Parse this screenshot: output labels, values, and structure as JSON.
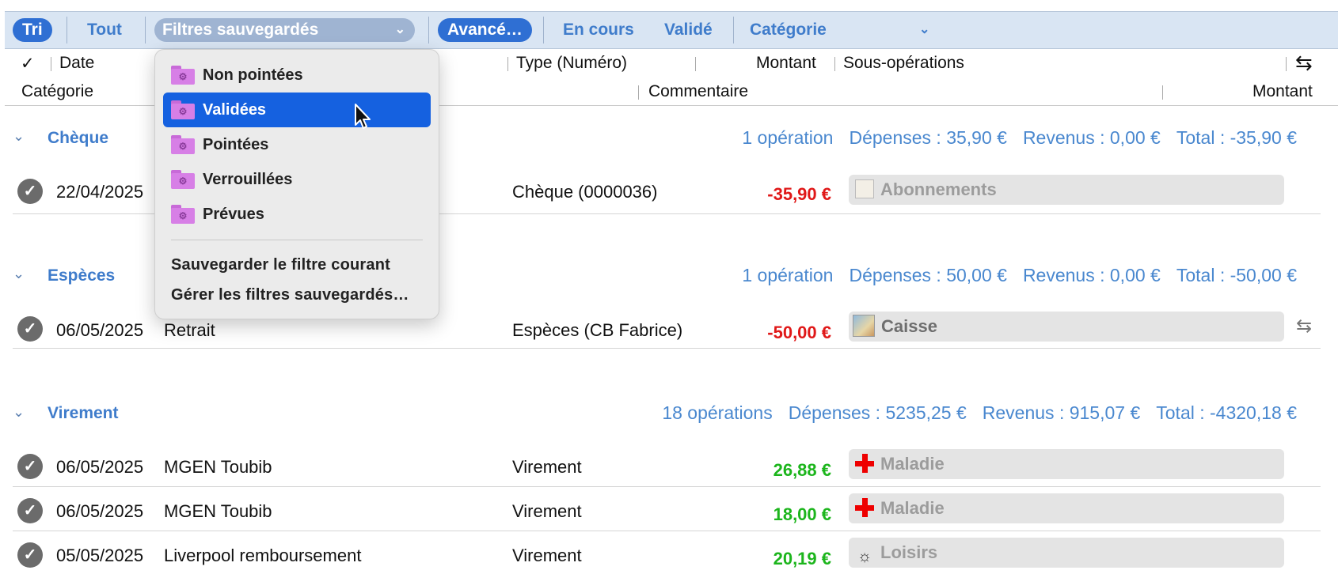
{
  "toolbar": {
    "sort": "Tri",
    "all": "Tout",
    "saved_filters": "Filtres sauvegardés",
    "advanced": "Avancé…",
    "in_progress": "En cours",
    "validated": "Validé",
    "category": "Catégorie"
  },
  "headers": {
    "check": "✓",
    "date": "Date",
    "type": "Type (Numéro)",
    "amount": "Montant",
    "sub_ops": "Sous-opérations",
    "category": "Catégorie",
    "comment": "Commentaire",
    "sub_amount": "Montant"
  },
  "menu": {
    "items": [
      "Non pointées",
      "Validées",
      "Pointées",
      "Verrouillées",
      "Prévues"
    ],
    "selected": "Validées",
    "save_current": "Sauvegarder le filtre courant",
    "manage": "Gérer les filtres sauvegardés…"
  },
  "groups": [
    {
      "title": "Chèque",
      "count": "1 opération",
      "expenses": "Dépenses : 35,90 €",
      "income": "Revenus : 0,00 €",
      "total": "Total : -35,90 €",
      "rows": [
        {
          "date": "22/04/2025",
          "label": "",
          "type": "Chèque (0000036)",
          "amount": "-35,90 €",
          "category": "Abonnements",
          "icon": "newspaper-icon"
        }
      ]
    },
    {
      "title": "Espèces",
      "count": "1 opération",
      "expenses": "Dépenses : 50,00 €",
      "income": "Revenus : 0,00 €",
      "total": "Total : -50,00 €",
      "rows": [
        {
          "date": "06/05/2025",
          "label": "Retrait",
          "type": "Espèces (CB Fabrice)",
          "amount": "-50,00 €",
          "category": "Caisse",
          "icon": "picture-icon"
        }
      ]
    },
    {
      "title": "Virement",
      "count": "18 opérations",
      "expenses": "Dépenses : 5235,25 €",
      "income": "Revenus : 915,07 €",
      "total": "Total : -4320,18 €",
      "rows": [
        {
          "date": "06/05/2025",
          "label": "MGEN Toubib",
          "type": "Virement",
          "amount": "26,88 €",
          "category": "Maladie",
          "icon": "red-cross-icon"
        },
        {
          "date": "06/05/2025",
          "label": "MGEN Toubib",
          "type": "Virement",
          "amount": "18,00 €",
          "category": "Maladie",
          "icon": "red-cross-icon"
        },
        {
          "date": "05/05/2025",
          "label": "Liverpool remboursement",
          "type": "Virement",
          "amount": "20,19 €",
          "category": "Loisirs",
          "icon": "leisure-icon"
        }
      ]
    }
  ],
  "colors": {
    "accent": "#2f6fd3",
    "group_text": "#3f7ccb",
    "negative": "#e01818",
    "positive": "#1cb51c",
    "menu_selection": "#1561e0"
  }
}
